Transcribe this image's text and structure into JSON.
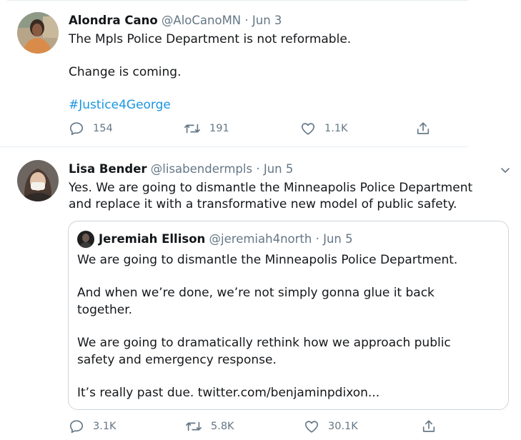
{
  "tweets": [
    {
      "name": "Alondra Cano",
      "handle": "@AloCanoMN",
      "separator": "·",
      "date": "Jun 3",
      "line1": "The Mpls Police Department is not reformable.",
      "line2": "Change is coming.",
      "hashtag": "#Justice4George",
      "replies": "154",
      "retweets": "191",
      "likes": "1.1K"
    },
    {
      "name": "Lisa Bender",
      "handle": "@lisabendermpls",
      "separator": "·",
      "date": "Jun 5",
      "line1": "Yes. We are going to dismantle the Minneapolis Police Department",
      "line2": "and replace it with a transformative new model of public safety.",
      "replies": "3.1K",
      "retweets": "5.8K",
      "likes": "30.1K",
      "quote": {
        "name": "Jeremiah Ellison",
        "handle": "@jeremiah4north",
        "separator": "·",
        "date": "Jun 5",
        "p1": "We are going to dismantle the Minneapolis Police Department.",
        "p2a": "And when we’re done, we’re not simply gonna glue it back",
        "p2b": "together.",
        "p3a": "We are going to dramatically rethink how we approach public",
        "p3b": "safety and emergency response.",
        "p4": "It’s really past due. twitter.com/benjaminpdixon..."
      }
    }
  ],
  "icons": {
    "reply": "reply-icon",
    "retweet": "retweet-icon",
    "like": "like-icon",
    "share": "share-icon",
    "more": "chevron-down-icon"
  },
  "colors": {
    "text": "#14171a",
    "secondary": "#657786",
    "link": "#1b95e0",
    "border": "#ccd6dd"
  }
}
